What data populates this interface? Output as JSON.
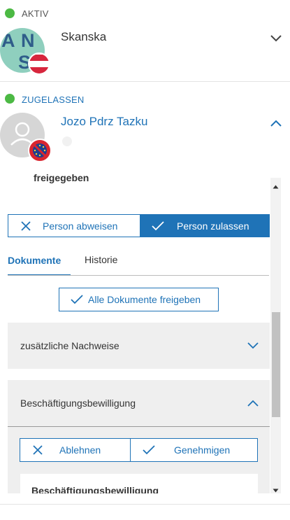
{
  "entries": [
    {
      "status": "AKTIV",
      "status_color": "#4cb944",
      "name": "Skanska",
      "avatar_letters": [
        "A",
        "N",
        "S"
      ],
      "flag": "austria-flag",
      "chevron": "chevron-down-icon"
    },
    {
      "status": "ZUGELASSEN",
      "status_color": "#4cb944",
      "name": "Jozo Pdrz Tazku",
      "avatar": "person-placeholder-icon",
      "flag": "eu-flag-crossed",
      "chevron": "chevron-up-icon"
    }
  ],
  "detail": {
    "released_label": "freigegeben",
    "reject_person_label": "Person abweisen",
    "approve_person_label": "Person zulassen",
    "tabs": [
      {
        "label": "Dokumente",
        "active": true
      },
      {
        "label": "Historie",
        "active": false
      }
    ],
    "release_all_label": "Alle Dokumente freigeben",
    "sections": [
      {
        "title": "zusätzliche Nachweise",
        "expanded": false
      },
      {
        "title": "Beschäftigungsbewilligung",
        "expanded": true
      }
    ],
    "reject_label": "Ablehnen",
    "accept_label": "Genehmigen",
    "document_title": "Beschäftigungsbewilligung"
  },
  "colors": {
    "accent": "#1f73b7",
    "status_green": "#4cb944",
    "panel_gray": "#efefef"
  }
}
